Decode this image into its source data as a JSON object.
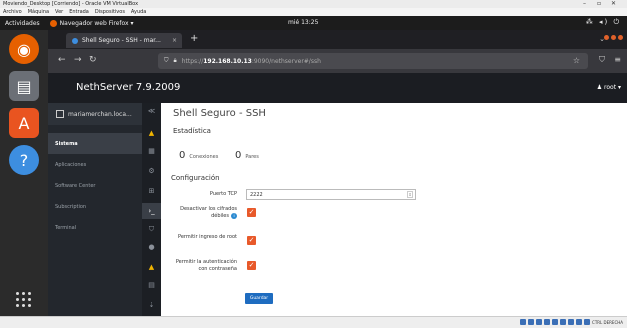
{
  "vbox": {
    "title": "Moviendo_Desktop [Corriendo] - Oracle VM VirtualBox",
    "menu": [
      "Archivo",
      "Máquina",
      "Ver",
      "Entrada",
      "Dispositivos",
      "Ayuda"
    ],
    "host_keys": "CTRL DERECHA"
  },
  "gnome": {
    "activities": "Actividades",
    "app_name": "Navegador web Firefox ▾",
    "clock": "mié 13:25"
  },
  "firefox": {
    "tab_title": "Shell Seguro - SSH - mar...",
    "tab_close": "×",
    "new_tab": "+",
    "url_prefix": "https://",
    "url_host": "192.168.10.13",
    "url_path": ":9090/nethserver#/ssh"
  },
  "nethserver": {
    "brand": "NethServer 7.9.2009",
    "user": "root ▾",
    "hostname": "mariamerchan.loca...",
    "menu": [
      {
        "label": "Sistema",
        "active": true
      },
      {
        "label": "Aplicaciones",
        "active": false
      },
      {
        "label": "Software Center",
        "active": false
      },
      {
        "label": "Subscription",
        "active": false
      },
      {
        "label": "Terminal",
        "active": false
      }
    ],
    "page_title": "Shell Seguro - SSH",
    "stats_heading": "Estadística",
    "stats": [
      {
        "value": "0",
        "label": "Conexiones"
      },
      {
        "value": "0",
        "label": "Pares"
      }
    ],
    "config_heading": "Configuración",
    "fields": {
      "tcp_port_label": "Puerto TCP",
      "tcp_port_value": "2222",
      "weak_ciphers_label": "Desactivar los cifrados débiles",
      "weak_ciphers_checked": true,
      "root_login_label": "Permitir ingreso de root",
      "root_login_checked": true,
      "password_auth_label": "Permitir la autenticación con contraseña",
      "password_auth_checked": true
    },
    "save_label": "Guardar",
    "check_glyph": "✓"
  },
  "colors": {
    "accent_orange": "#e8592a",
    "button_blue": "#1e6cc0",
    "sidebar_dark": "#23272d",
    "firefox_chrome": "#38383d"
  }
}
